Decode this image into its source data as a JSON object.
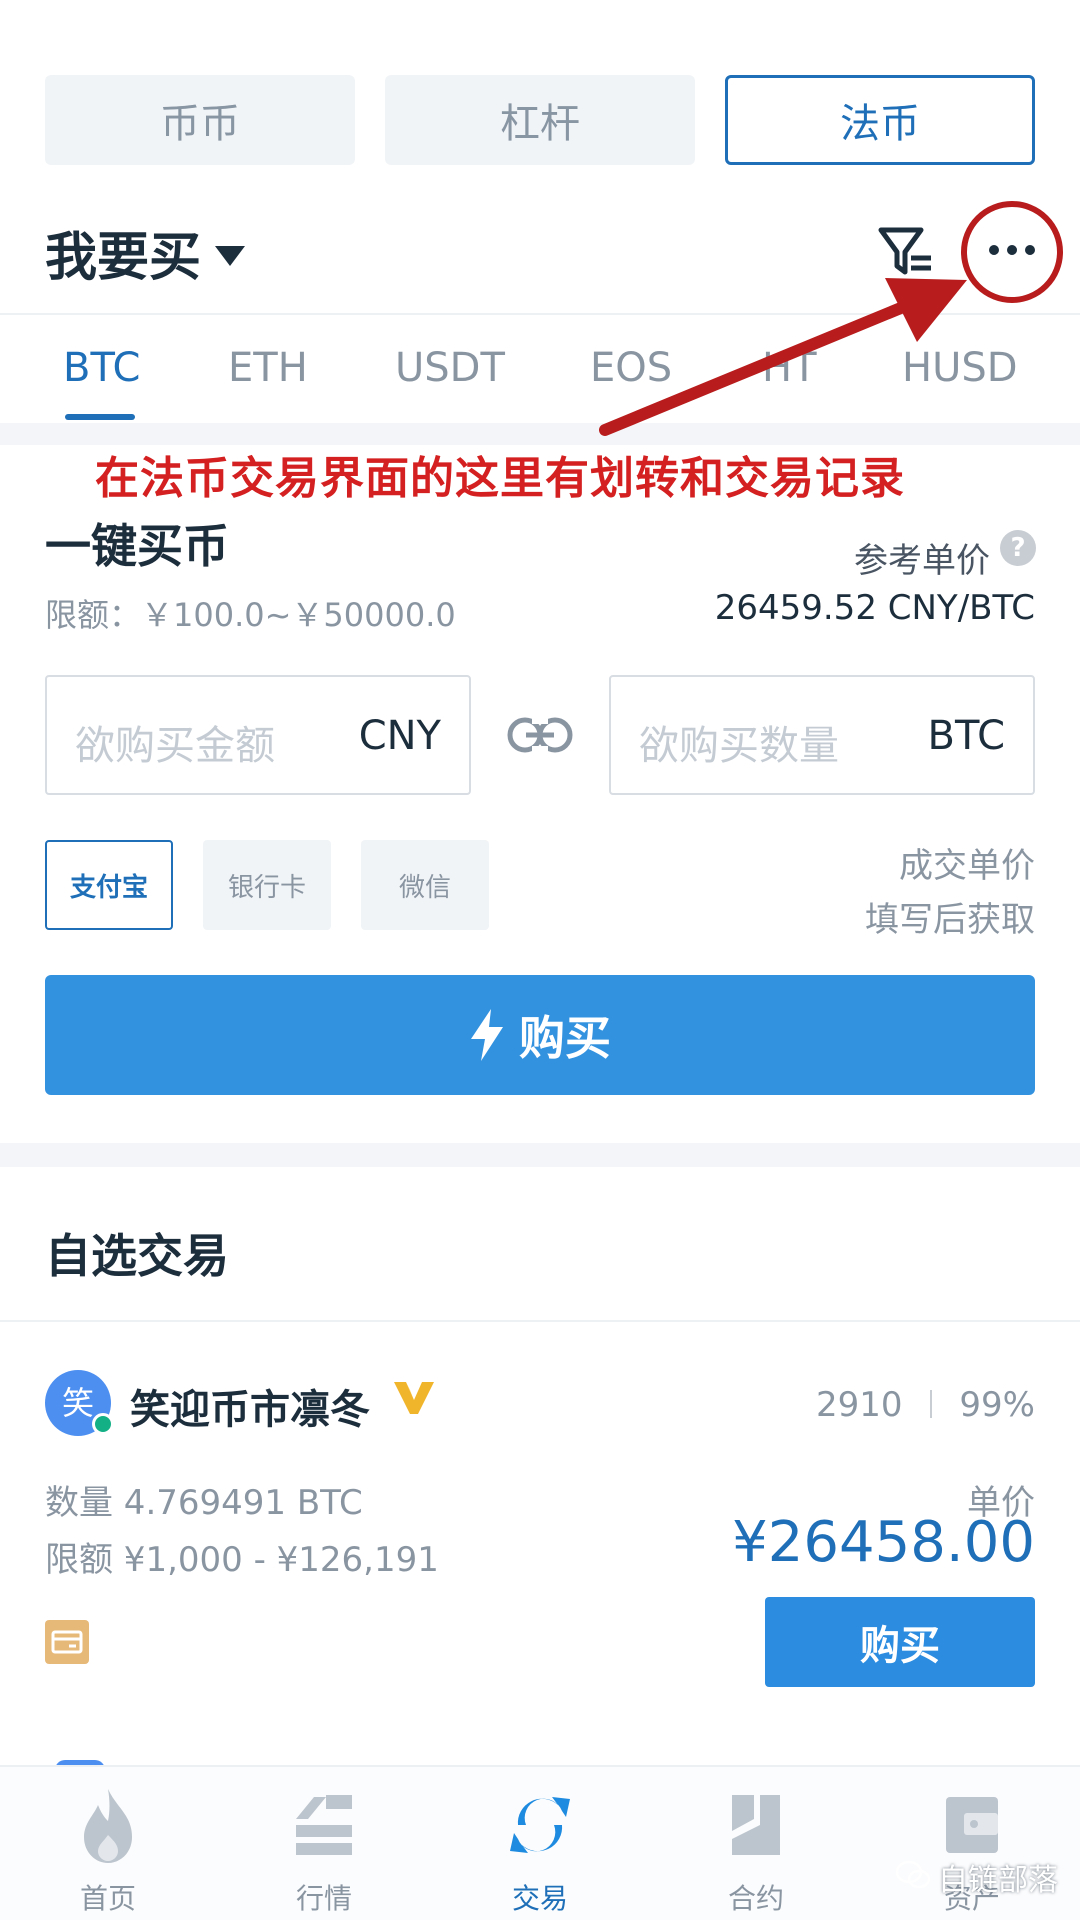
{
  "segments": [
    {
      "label": "币币",
      "active": false
    },
    {
      "label": "杠杆",
      "active": false
    },
    {
      "label": "法币",
      "active": true
    }
  ],
  "header": {
    "title": "我要买",
    "filter_icon": "filter-icon",
    "more_icon": "more-icon"
  },
  "coin_tabs": [
    "BTC",
    "ETH",
    "USDT",
    "EOS",
    "HT",
    "HUSD"
  ],
  "annotation": "在法币交易界面的这里有划转和交易记录",
  "quick_buy": {
    "title": "一键买币",
    "limit": "限额：￥100.0~￥50000.0",
    "ref_price_label": "参考单价",
    "ref_price_value": "26459.52 CNY/BTC",
    "amount_placeholder": "欲购买金额",
    "amount_unit": "CNY",
    "qty_placeholder": "欲购买数量",
    "qty_unit": "BTC",
    "pay_methods": [
      {
        "label": "支付宝",
        "active": true
      },
      {
        "label": "银行卡",
        "active": false
      },
      {
        "label": "微信",
        "active": false
      }
    ],
    "deal_price_line1": "成交单价",
    "deal_price_line2": "填写后获取",
    "buy_label": "购买"
  },
  "favorites": {
    "title": "自选交易",
    "merchant": {
      "avatar_char": "笑",
      "name": "笑迎币市凛冬",
      "orders": "2910",
      "rate": "99%",
      "quantity": "数量 4.769491  BTC",
      "limit": "限额 ¥1,000 - ¥126,191",
      "unit_price_label": "单价",
      "price": "¥26458.00",
      "buy_label": "购买"
    }
  },
  "bottom_nav": [
    {
      "label": "首页",
      "icon": "flame-icon",
      "active": false
    },
    {
      "label": "行情",
      "icon": "chart-icon",
      "active": false
    },
    {
      "label": "交易",
      "icon": "exchange-icon",
      "active": true
    },
    {
      "label": "合约",
      "icon": "contract-icon",
      "active": false
    },
    {
      "label": "资产",
      "icon": "wallet-icon",
      "active": false
    }
  ],
  "watermark": "自链部落",
  "colors": {
    "accent": "#1e6fb8",
    "button": "#3392e0",
    "annotation": "#d42020"
  }
}
